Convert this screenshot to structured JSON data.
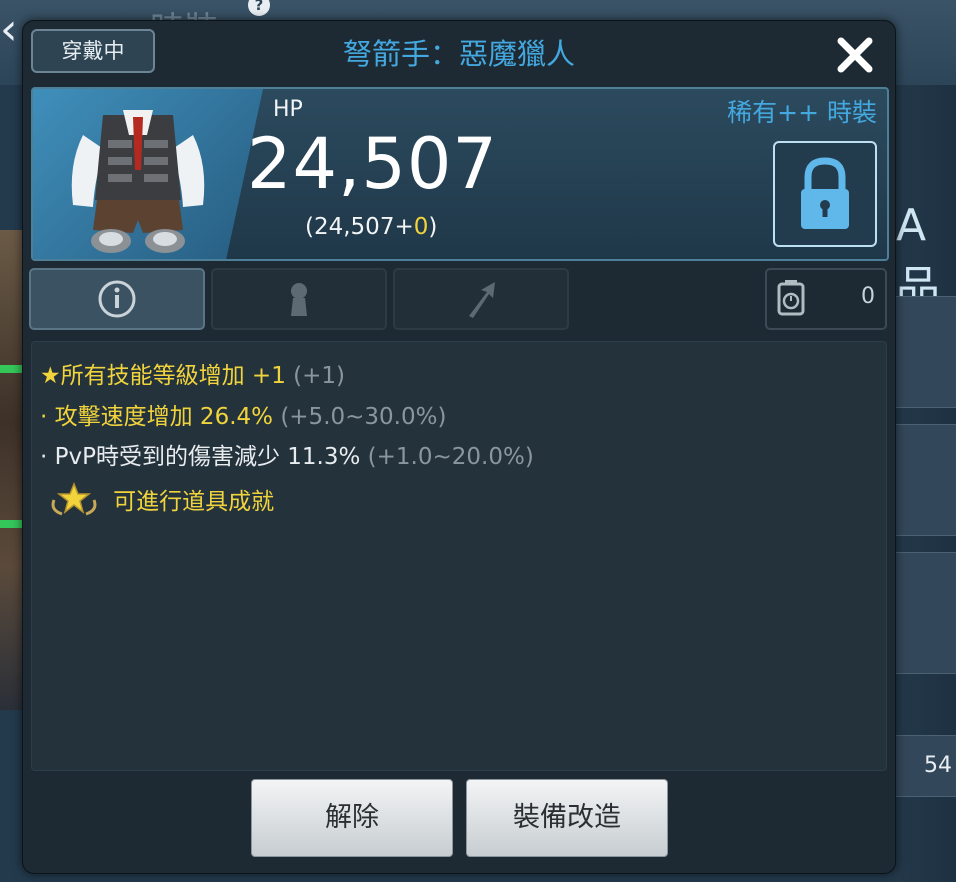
{
  "background": {
    "title": "時裝",
    "help_icon": "question-mark-icon",
    "side_letters": "A品",
    "side_number": "54"
  },
  "popup": {
    "status_badge": "穿戴中",
    "title": "弩箭手：惡魔獵人",
    "hp_label": "HP",
    "hp_value": "24,507",
    "hp_breakdown_base": "(24,507+",
    "hp_breakdown_bonus": "0",
    "hp_breakdown_close": ")",
    "rarity": "稀有++ 時裝",
    "tabs": [
      {
        "icon": "info-icon",
        "active": true
      },
      {
        "icon": "character-icon",
        "active": false
      },
      {
        "icon": "upgrade-arrow-icon",
        "active": false
      }
    ],
    "counter": {
      "icon": "scale-icon",
      "value": "0"
    },
    "stats": {
      "main_label": "★所有技能等級增加 +1",
      "main_range": "(+1)",
      "sub1_label": "· 攻擊速度增加 26.4%",
      "sub1_range": "(+5.0~30.0%)",
      "sub2_prefix": "· PvP時受到的傷害減少 11.3%",
      "sub2_range": "(+1.0~20.0%)",
      "achievement": "可進行道具成就"
    },
    "buttons": {
      "unequip": "解除",
      "modify": "裝備改造"
    }
  },
  "colors": {
    "title_blue": "#44a8e0",
    "highlight_yellow": "#f1d43c"
  }
}
